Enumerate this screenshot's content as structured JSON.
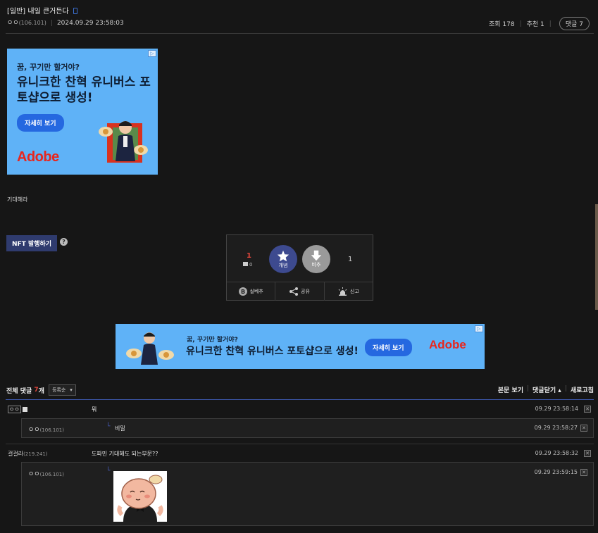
{
  "post": {
    "title": "[일반] 내일 큰거든다",
    "author": "ㅇㅇ",
    "author_ip": "(106.101)",
    "date": "2024.09.29 23:58:03",
    "views": "조회 178",
    "recommends": "추천 1",
    "comments_pill": "댓글 7",
    "body": "기대해라"
  },
  "ad_top": {
    "line1": "꿈, 꾸기만 할거야?",
    "line2": "유니크한 찬혁 유니버스 포토샵으로 생성!",
    "button": "자세히 보기",
    "brand": "Adobe",
    "info_icon": "ad-info-icon"
  },
  "nft": {
    "button": "NFT 발행하기",
    "help": "?"
  },
  "vote": {
    "up_count": "1",
    "fix_count": "0",
    "up_label": "개념",
    "down_label": "비추",
    "down_count": "1",
    "actions": [
      "실베추",
      "공유",
      "신고"
    ],
    "colors": {
      "up": "#3d4a8f",
      "down": "#9a9a9a"
    }
  },
  "ad_bottom": {
    "line1": "꿈, 꾸기만 할거야?",
    "line2": "유니크한 찬혁 유니버스 포토샵으로 생성!",
    "button": "자세히 보기",
    "brand": "Adobe"
  },
  "comments_header": {
    "label": "전체 댓글",
    "count": "7",
    "count_suffix": "개",
    "sort": "등록순",
    "view_body": "본문 보기",
    "collapse": "댓글닫기",
    "refresh": "새로고침"
  },
  "comments": [
    {
      "nick": "ㅇㅇ",
      "ip": "",
      "text": "뭐",
      "time": "09.29 23:58:14",
      "reply": {
        "nick": "ㅇㅇ",
        "ip": "(106.101)",
        "text": "비밀",
        "time": "09.29 23:58:27"
      }
    },
    {
      "nick": "걸걸라",
      "ip": "(219.241)",
      "text": "도파민 기대해도 되는부문??",
      "time": "09.29 23:58:32",
      "reply": {
        "nick": "ㅇㅇ",
        "ip": "(106.101)",
        "text": "",
        "time": "09.29 23:59:15",
        "sticker": "dccon-sticker"
      }
    }
  ]
}
